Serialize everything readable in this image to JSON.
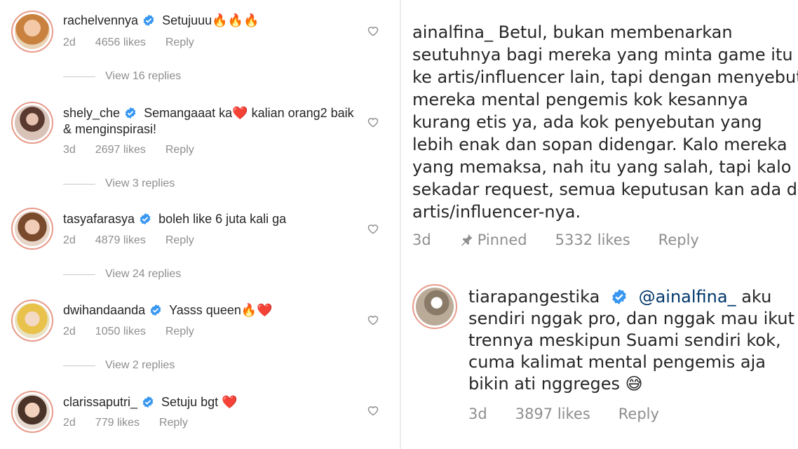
{
  "left_comments": [
    {
      "username": "rachelvennya",
      "text": "Setujuuu🔥🔥🔥",
      "age": "2d",
      "likes": "4656 likes",
      "reply": "Reply",
      "view_replies": "View 16 replies"
    },
    {
      "username": "shely_che",
      "text": "Semangaaat ka❤️ kalian orang2 baik & menginspirasi!",
      "age": "3d",
      "likes": "2697 likes",
      "reply": "Reply",
      "view_replies": "View 3 replies"
    },
    {
      "username": "tasyafarasya",
      "text": "boleh like 6 juta kali ga",
      "age": "2d",
      "likes": "4879 likes",
      "reply": "Reply",
      "view_replies": "View 24 replies"
    },
    {
      "username": "dwihandaanda",
      "text": "Yasss queen🔥❤️",
      "age": "2d",
      "likes": "1050 likes",
      "reply": "Reply",
      "view_replies": "View 2 replies"
    },
    {
      "username": "clarissaputri_",
      "text": "Setuju bgt ❤️",
      "age": "2d",
      "likes": "779 likes",
      "reply": "Reply"
    }
  ],
  "pinned": {
    "username": "ainalfina_",
    "text": "Betul, bukan membenarkan seutuhnya bagi mereka yang minta game itu ke artis/influencer lain, tapi dengan menyebut mereka mental pengemis kok kesannya kurang etis ya, ada kok penyebutan yang lebih enak dan sopan didengar. Kalo mereka yang memaksa, nah itu yang salah, tapi kalo sekadar request, semua keputusan kan ada di artis/influencer-nya.",
    "age": "3d",
    "pinned_label": "Pinned",
    "likes": "5332 likes",
    "reply": "Reply"
  },
  "reply_comment": {
    "username": "tiarapangestika",
    "mention": "@ainalfina_",
    "text": "aku sendiri nggak pro, dan nggak mau ikut trennya meskipun Suami sendiri kok, cuma kalimat mental pengemis aja bikin ati nggreges 😅",
    "age": "3d",
    "likes": "3897 likes",
    "reply": "Reply"
  },
  "colors": {
    "verified": "#3897f0",
    "meta": "#8e8e8e",
    "text": "#262626",
    "mention": "#00376b"
  },
  "icons": [
    "verified-badge-icon",
    "heart-icon",
    "pin-icon"
  ]
}
